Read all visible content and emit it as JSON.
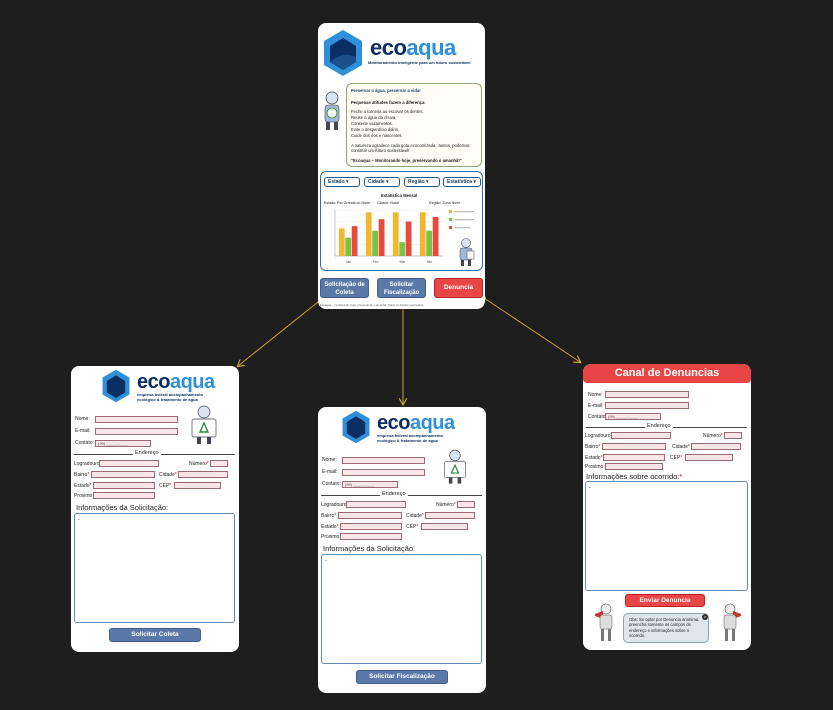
{
  "main_screen": {
    "logo_word_eco": "eco",
    "logo_word_aqua": "aqua",
    "tagline": "Monitoramento inteligente para um futuro sustentável",
    "info_title": "Preservar a água, preservar a vida!",
    "info_subtitle": "Pequenas atitudes fazem a diferença:",
    "info_items": [
      "Feche a torneira ao escovar os dentes.",
      "Reuse a água da chuva.",
      "Conserte vazamentos.",
      "Evite o desperdício diário.",
      "Cuide dos rios e nascentes."
    ],
    "info_para": "A natureza agradece cada gota economizada. Juntos, podemos construir um futuro sustentável!",
    "info_footer": "\"Ecoaqua – Monitorando hoje, preservando o amanhã!\"",
    "filters": [
      "Estado",
      "Cidade",
      "Região",
      "Estatística"
    ],
    "chart_subtitle_left": "Estado: Rio Grande do Norte",
    "chart_subtitle_mid": "Cidade: Natal",
    "chart_subtitle_right": "Região: Zona Norte",
    "chart_title": "Estatística Mensal",
    "buttons": {
      "collect": "Solicitação de Coleta",
      "inspect": "Solicitar Fiscalização",
      "report": "Denuncia"
    },
    "footer_text": "Ecoaqua – monitorando hoje, preservando o amanhã. Todos os direitos reservados."
  },
  "chart_data": {
    "type": "bar",
    "categories": [
      "Jan",
      "Fev",
      "Mar",
      "Abr"
    ],
    "series": [
      {
        "name": "",
        "color": "#f2b731",
        "values": [
          60,
          95,
          95,
          95
        ]
      },
      {
        "name": "",
        "color": "#7cc142",
        "values": [
          40,
          55,
          30,
          55
        ]
      },
      {
        "name": "",
        "color": "#e84a3c",
        "values": [
          65,
          80,
          75,
          85
        ]
      }
    ],
    "ylim": [
      0,
      100
    ]
  },
  "form_collect": {
    "logo_word_eco": "eco",
    "logo_word_aqua": "aqua",
    "logo_sub": "empresa federal acompanhamento ecológico & tratamento de agua",
    "fields": {
      "name": "Nome:",
      "email": "E-mail:",
      "contact": "Contato:",
      "contact_placeholder": "(99) _____-____",
      "address_divider": "Endereço",
      "street": "Logradouro",
      "number": "Número",
      "district": "Bairro",
      "city": "Cidade",
      "state": "Estado",
      "cep": "CEP",
      "near": "Proximo:"
    },
    "info_label": "Informações da Solicitação:",
    "textarea_value": "-",
    "button": "Solicitar  Coleta"
  },
  "form_inspect": {
    "logo_word_eco": "eco",
    "logo_word_aqua": "aqua",
    "logo_sub": "empresa federal acompanhamento ecológico & tratamento de agua",
    "fields": {
      "name": "Nome:",
      "email": "E-mail:",
      "contact": "Contato:",
      "contact_placeholder": "(99) _____-____",
      "address_divider": "Endereço",
      "street": "Logradouro",
      "number": "Número",
      "district": "Bairro",
      "city": "Cidade",
      "state": "Estado",
      "cep": "CEP",
      "near": "Proximo:"
    },
    "info_label": "Informações da Solicitação:",
    "textarea_value": "-",
    "button": "Solicitar Fiscalização"
  },
  "form_report": {
    "header": "Canal de Denuncias",
    "fields": {
      "name": "Nome:",
      "email": "E-mail:",
      "contact": "Contato:",
      "contact_placeholder": "(99) _____-____",
      "address_divider": "Endereço",
      "street": "Logradouro",
      "number": "Número",
      "district": "Bairro",
      "city": "Cidade",
      "state": "Estado",
      "cep": "CEP",
      "near": "Proximo:"
    },
    "info_label": "Informações sobre ocorrido:",
    "textarea_value": "-",
    "button": "Enviar Denuncia",
    "notice": "Obs: Se optar por Denuncia anonima, preencha somente os campos de endereço e informações sobre o ocorrido."
  },
  "colors": {
    "canvas": "#1e1e1e",
    "connector": "#c9a227",
    "brand_dark": "#0b2f63",
    "brand_light": "#2d90d8",
    "button_blue": "#5a79a8",
    "button_red": "#e84646",
    "input_fill": "#fde6e9"
  }
}
